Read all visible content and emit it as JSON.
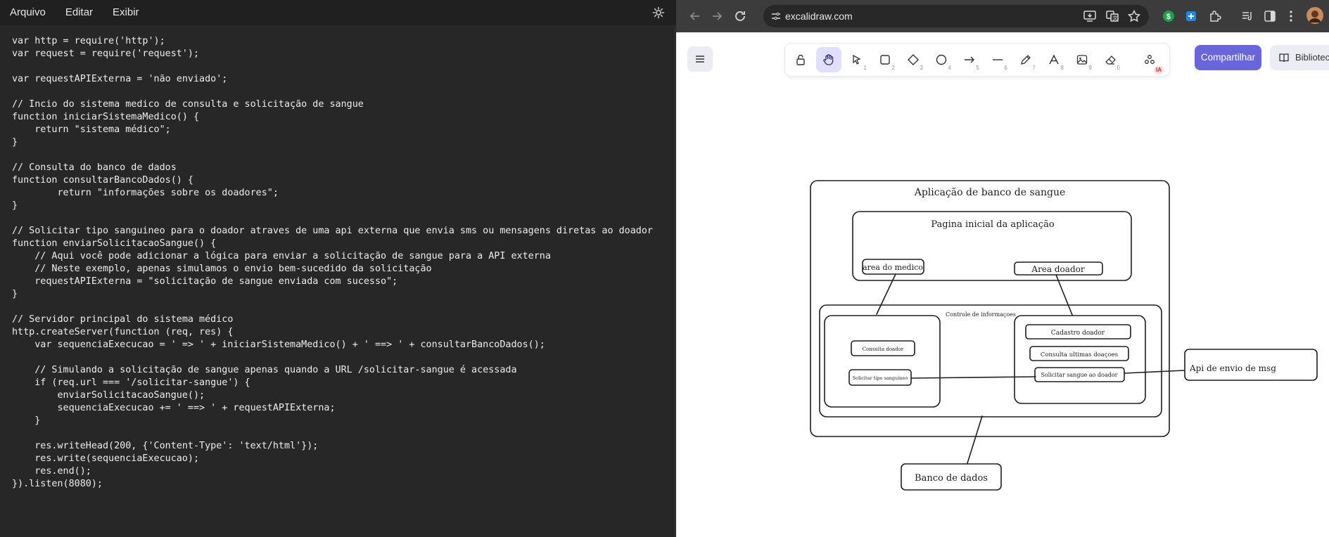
{
  "editor": {
    "menu": [
      "Arquivo",
      "Editar",
      "Exibir"
    ],
    "settings_icon": "gear-icon",
    "code_lines": [
      "var http = require('http');",
      "var request = require('request');",
      "",
      "var requestAPIExterna = 'não enviado';",
      "",
      "// Incio do sistema medico de consulta e solicitação de sangue",
      "function iniciarSistemaMedico() {",
      "    return \"sistema médico\";",
      "}",
      "",
      "// Consulta do banco de dados",
      "function consultarBancoDados() {",
      "        return \"informações sobre os doadores\";",
      "}",
      "",
      "// Solicitar tipo sanguineo para o doador atraves de uma api externa que envia sms ou mensagens diretas ao doador",
      "function enviarSolicitacaoSangue() {",
      "    // Aqui você pode adicionar a lógica para enviar a solicitação de sangue para a API externa",
      "    // Neste exemplo, apenas simulamos o envio bem-sucedido da solicitação",
      "    requestAPIExterna = \"solicitação de sangue enviada com sucesso\";",
      "}",
      "",
      "// Servidor principal do sistema médico",
      "http.createServer(function (req, res) {",
      "    var sequenciaExecucao = ' => ' + iniciarSistemaMedico() + ' ==> ' + consultarBancoDados();",
      "",
      "    // Simulando a solicitação de sangue apenas quando a URL /solicitar-sangue é acessada",
      "    if (req.url === '/solicitar-sangue') {",
      "        enviarSolicitacaoSangue();",
      "        sequenciaExecucao += ' ==> ' + requestAPIExterna;",
      "    }",
      "",
      "    res.writeHead(200, {'Content-Type': 'text/html'});",
      "    res.write(sequenciaExecucao);",
      "    res.end();",
      "}).listen(8080);"
    ]
  },
  "browser": {
    "url": "excalidraw.com",
    "colors": {
      "chrome": "#3c3c3c",
      "omnibox": "#282828",
      "accent": "#6965db"
    }
  },
  "excalidraw": {
    "tools": [
      {
        "icon": "lock-icon",
        "num": ""
      },
      {
        "icon": "hand-icon",
        "num": ""
      },
      {
        "icon": "select-icon",
        "num": "1"
      },
      {
        "icon": "rectangle-icon",
        "num": "2"
      },
      {
        "icon": "diamond-icon",
        "num": "3"
      },
      {
        "icon": "ellipse-icon",
        "num": "4"
      },
      {
        "icon": "arrow-icon",
        "num": "5"
      },
      {
        "icon": "line-icon",
        "num": "6"
      },
      {
        "icon": "pencil-icon",
        "num": "7"
      },
      {
        "icon": "text-icon",
        "num": "8"
      },
      {
        "icon": "image-icon",
        "num": "9"
      },
      {
        "icon": "eraser-icon",
        "num": "0"
      },
      {
        "icon": "extra-tools-icon",
        "num": ""
      }
    ],
    "ai_badge": "IA",
    "share_label": "Compartilhar",
    "library_label": "Biblioteca",
    "diagram": {
      "app_title": "Aplicação de banco de sangue",
      "home_title": "Pagina inicial da aplicação",
      "area_medico": "area do medico",
      "area_doador": "Area doador",
      "controle": "Controle de informaçoes",
      "consulta_doador": "Consulta doador",
      "solicitar_tipo": "Solicitar tipo sanguineo",
      "cadastro_doador": "Cadastro doador",
      "consulta_ultimas": "Consulta ultimas doaçoes",
      "solicitar_sangue": "Solicitar sangue ao doador",
      "api_msg": "Api de envio de msg",
      "banco_dados": "Banco de dados"
    }
  }
}
